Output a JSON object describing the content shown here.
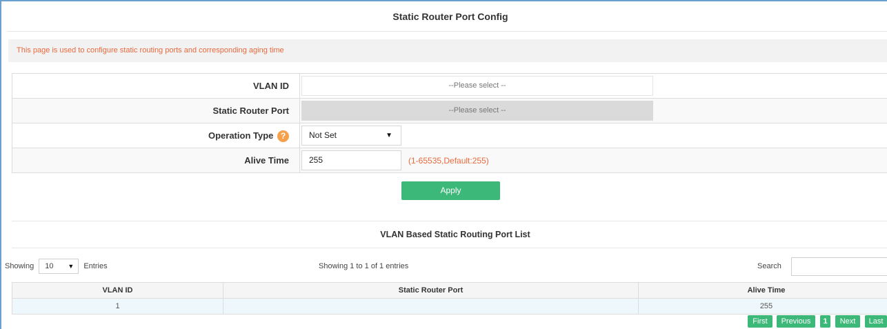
{
  "page": {
    "title": "Static Router Port Config",
    "info": "This page is used to configure static routing ports and corresponding aging time"
  },
  "form": {
    "vlan_id": {
      "label": "VLAN ID",
      "value": "--Please select --"
    },
    "static_router_port": {
      "label": "Static Router Port",
      "value": "--Please select --"
    },
    "operation_type": {
      "label": "Operation Type",
      "help": "?",
      "value": "Not Set"
    },
    "alive_time": {
      "label": "Alive Time",
      "value": "255",
      "hint": "(1-65535,Default:255)"
    },
    "apply_label": "Apply"
  },
  "list": {
    "title": "VLAN Based Static Routing Port List",
    "showing_prefix": "Showing",
    "entries_value": "10",
    "entries_suffix": "Entries",
    "info": "Showing 1 to 1 of 1 entries",
    "search_label": "Search",
    "columns": [
      "VLAN ID",
      "Static Router Port",
      "Alive Time"
    ],
    "rows": [
      {
        "vlan_id": "1",
        "static_router_port": "",
        "alive_time": "255"
      }
    ]
  },
  "pager": {
    "first": "First",
    "previous": "Previous",
    "current": "1",
    "next": "Next",
    "last": "Last"
  },
  "colors": {
    "accent_green": "#3cb878",
    "info_orange": "#e8693c",
    "help_icon_orange": "#f5a04a"
  },
  "icons": {
    "help": "question-circle-icon",
    "dropdown": "chevron-down-icon"
  }
}
